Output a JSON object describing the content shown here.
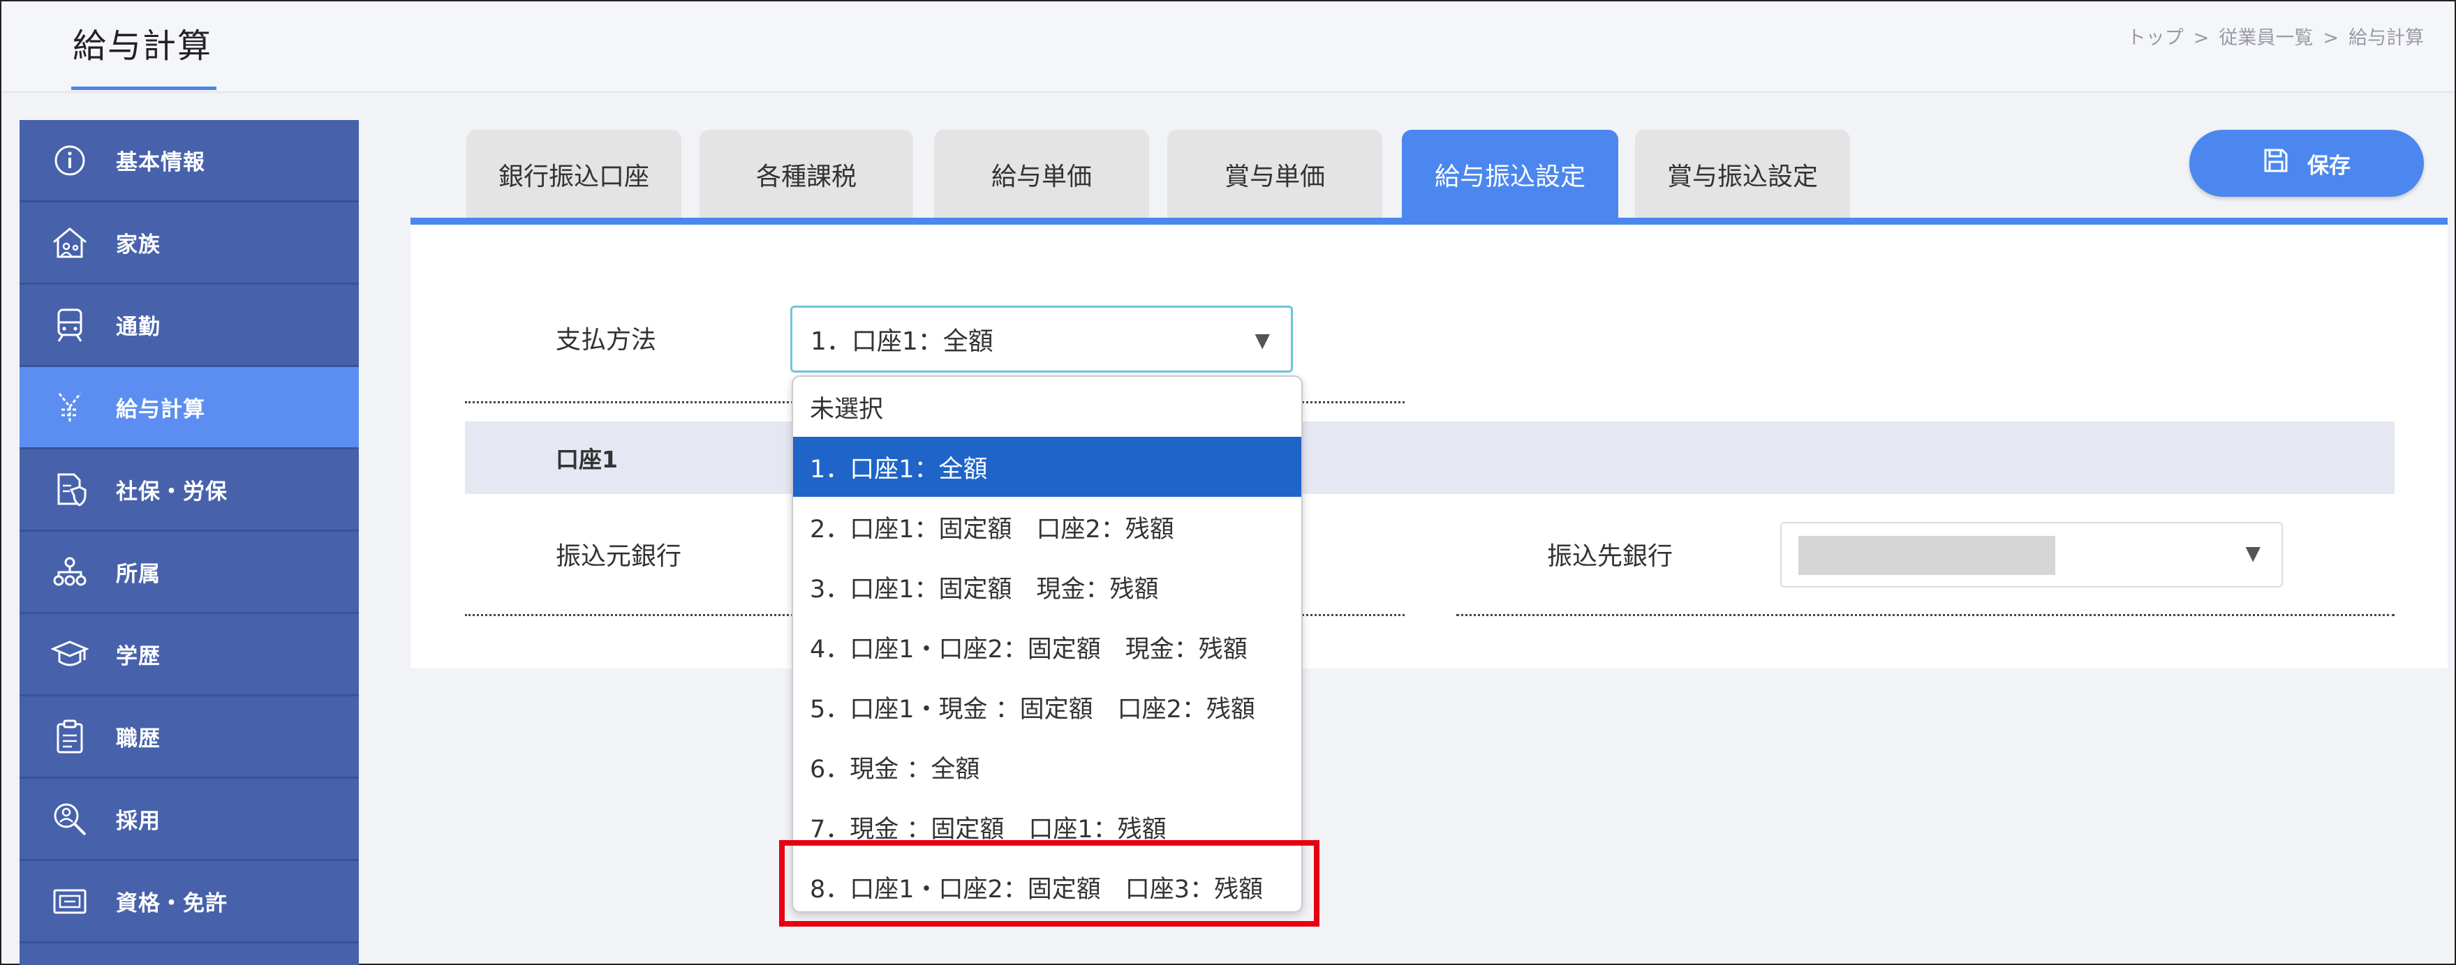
{
  "header": {
    "page_title": "給与計算",
    "breadcrumb": [
      "トップ",
      "従業員一覧",
      "給与計算"
    ],
    "breadcrumb_sep": ">"
  },
  "sidebar": {
    "items": [
      {
        "label": "基本情報",
        "icon": "info-icon"
      },
      {
        "label": "家族",
        "icon": "house-icon"
      },
      {
        "label": "通勤",
        "icon": "train-icon"
      },
      {
        "label": "給与計算",
        "icon": "yen-icon"
      },
      {
        "label": "社保・労保",
        "icon": "document-shield-icon"
      },
      {
        "label": "所属",
        "icon": "org-chart-icon"
      },
      {
        "label": "学歴",
        "icon": "graduation-cap-icon"
      },
      {
        "label": "職歴",
        "icon": "clipboard-icon"
      },
      {
        "label": "採用",
        "icon": "magnifier-person-icon"
      },
      {
        "label": "資格・免許",
        "icon": "certificate-icon"
      }
    ],
    "active_index": 3
  },
  "tabs": [
    {
      "label": "銀行振込口座"
    },
    {
      "label": "各種課税"
    },
    {
      "label": "給与単価"
    },
    {
      "label": "賞与単価"
    },
    {
      "label": "給与振込設定"
    },
    {
      "label": "賞与振込設定"
    }
  ],
  "active_tab": 4,
  "toolbar": {
    "save_label": "保存",
    "save_icon": "floppy-disk-icon"
  },
  "form": {
    "payment_method_label": "支払方法",
    "payment_method_value": "1．口座1：全額",
    "section_title": "口座1",
    "source_bank_label": "振込元銀行",
    "dest_bank_label": "振込先銀行"
  },
  "dropdown": {
    "options": [
      "未選択",
      "1．口座1：全額",
      "2．口座1：固定額　口座2：残額",
      "3．口座1：固定額　現金：残額",
      "4．口座1・口座2：固定額　現金：残額",
      "5．口座1・現金 ：固定額　口座2：残額",
      "6．現金 ：全額",
      "7．現金 ：固定額　口座1：残額",
      "8．口座1・口座2：固定額　口座3：残額"
    ],
    "selected_index": 1,
    "highlighted_index": 8
  },
  "colors": {
    "sidebar": "#4762ab",
    "accent": "#4b87ef",
    "selected_option": "#1f64c9",
    "highlight": "#e60012"
  }
}
